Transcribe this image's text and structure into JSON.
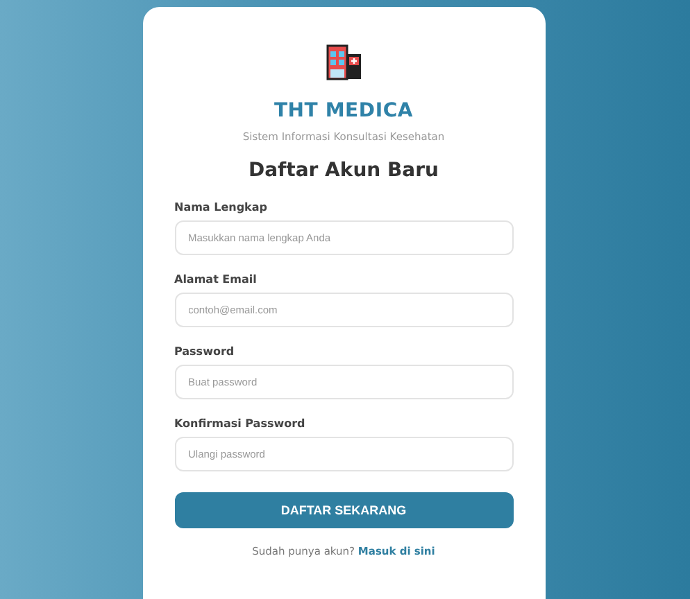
{
  "brand": {
    "title": "THT MEDICA",
    "subtitle": "Sistem Informasi Konsultasi Kesehatan"
  },
  "heading": "Daftar Akun Baru",
  "fields": [
    {
      "label": "Nama Lengkap",
      "placeholder": "Masukkan nama lengkap Anda"
    },
    {
      "label": "Alamat Email",
      "placeholder": "contoh@email.com"
    },
    {
      "label": "Password",
      "placeholder": "Buat password"
    },
    {
      "label": "Konfirmasi Password",
      "placeholder": "Ulangi password"
    }
  ],
  "submit": "DAFTAR SEKARANG",
  "footer": {
    "text": "Sudah punya akun?",
    "link": "Masuk di sini"
  }
}
